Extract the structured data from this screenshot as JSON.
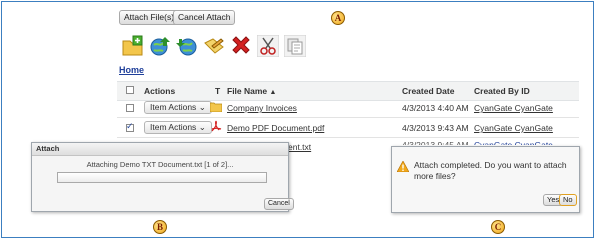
{
  "toolbar": {
    "attach_label": "Attach File(s)",
    "cancel_label": "Cancel Attach",
    "tools": [
      "new-folder-icon",
      "upload-icon",
      "download-icon",
      "edit-icon",
      "delete-icon",
      "cut-icon",
      "paste-icon"
    ]
  },
  "breadcrumb": {
    "home": "Home"
  },
  "table": {
    "headers": {
      "actions": "Actions",
      "type": "T",
      "file_name": "File Name",
      "sort": "▲",
      "created_date": "Created Date",
      "created_by": "Created By ID"
    },
    "rows": [
      {
        "action": "Item Actions",
        "name": "Company Invoices",
        "date": "4/3/2013 4:40 AM",
        "by": "CyanGate CyanGate",
        "checked": false
      },
      {
        "action": "Item Actions",
        "name": "Demo PDF Document.pdf",
        "date": "4/3/2013 9:43 AM",
        "by": "CyanGate CyanGate",
        "checked": true
      },
      {
        "name_partial": "ent.txt",
        "date_partial": "4/3/2013 9:45 AM",
        "by_partial": "CyanGate CyanGate"
      }
    ]
  },
  "dialog_b": {
    "title": "Attach",
    "message": "Attaching Demo TXT Document.txt [1 of 2]...",
    "progress": 0,
    "cancel_label": "Cancel"
  },
  "dialog_c": {
    "message": "Attach completed. Do you want to attach more files?",
    "yes_label": "Yes",
    "no_label": "No"
  },
  "markers": {
    "a": "A",
    "b": "B",
    "c": "C"
  },
  "colors": {
    "frame": "#3c7fc0",
    "link": "#1f3f9a",
    "warning": "#f0a81c",
    "delete": "#d42020"
  }
}
